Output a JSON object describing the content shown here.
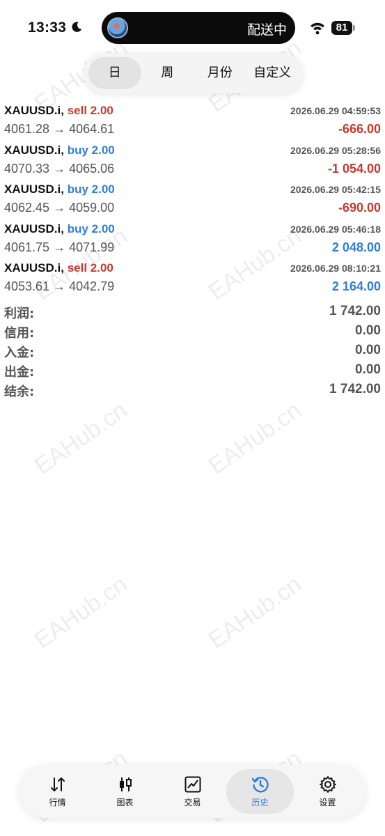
{
  "status_bar": {
    "time": "13:33",
    "island_text": "配送中",
    "battery": "81"
  },
  "period_tabs": [
    {
      "label": "日",
      "active": true
    },
    {
      "label": "周",
      "active": false
    },
    {
      "label": "月份",
      "active": false
    },
    {
      "label": "自定义",
      "active": false
    }
  ],
  "deals": [
    {
      "symbol": "XAUUSD.i,",
      "side": "sell",
      "volume": "sell 2.00",
      "time": "2026.06.29 04:59:53",
      "prices": "4061.28 → 4064.61",
      "profit": "-666.00",
      "profit_sign": "neg"
    },
    {
      "symbol": "XAUUSD.i,",
      "side": "buy",
      "volume": "buy 2.00",
      "time": "2026.06.29 05:28:56",
      "prices": "4070.33 → 4065.06",
      "profit": "-1 054.00",
      "profit_sign": "neg"
    },
    {
      "symbol": "XAUUSD.i,",
      "side": "buy",
      "volume": "buy 2.00",
      "time": "2026.06.29 05:42:15",
      "prices": "4062.45 → 4059.00",
      "profit": "-690.00",
      "profit_sign": "neg"
    },
    {
      "symbol": "XAUUSD.i,",
      "side": "buy",
      "volume": "buy 2.00",
      "time": "2026.06.29 05:46:18",
      "prices": "4061.75 → 4071.99",
      "profit": "2 048.00",
      "profit_sign": "pos"
    },
    {
      "symbol": "XAUUSD.i,",
      "side": "sell",
      "volume": "sell 2.00",
      "time": "2026.06.29 08:10:21",
      "prices": "4053.61 → 4042.79",
      "profit": "2 164.00",
      "profit_sign": "pos"
    }
  ],
  "summary": [
    {
      "label": "利润:",
      "value": "1 742.00"
    },
    {
      "label": "信用:",
      "value": "0.00"
    },
    {
      "label": "入金:",
      "value": "0.00"
    },
    {
      "label": "出金:",
      "value": "0.00"
    },
    {
      "label": "结余:",
      "value": "1 742.00"
    }
  ],
  "watermark": "EAHub.cn",
  "bottom_nav": [
    {
      "label": "行情",
      "icon": "quotes-arrows-icon",
      "active": false
    },
    {
      "label": "图表",
      "icon": "candlestick-chart-icon",
      "active": false
    },
    {
      "label": "交易",
      "icon": "trade-chart-icon",
      "active": false
    },
    {
      "label": "历史",
      "icon": "history-clock-icon",
      "active": true
    },
    {
      "label": "设置",
      "icon": "gear-icon",
      "active": false
    }
  ],
  "colors": {
    "sell": "#c63a2f",
    "buy": "#2f7ddb",
    "negative": "#c63a2f",
    "positive": "#2f7ddb",
    "active_tab": "#2f7ddb"
  }
}
